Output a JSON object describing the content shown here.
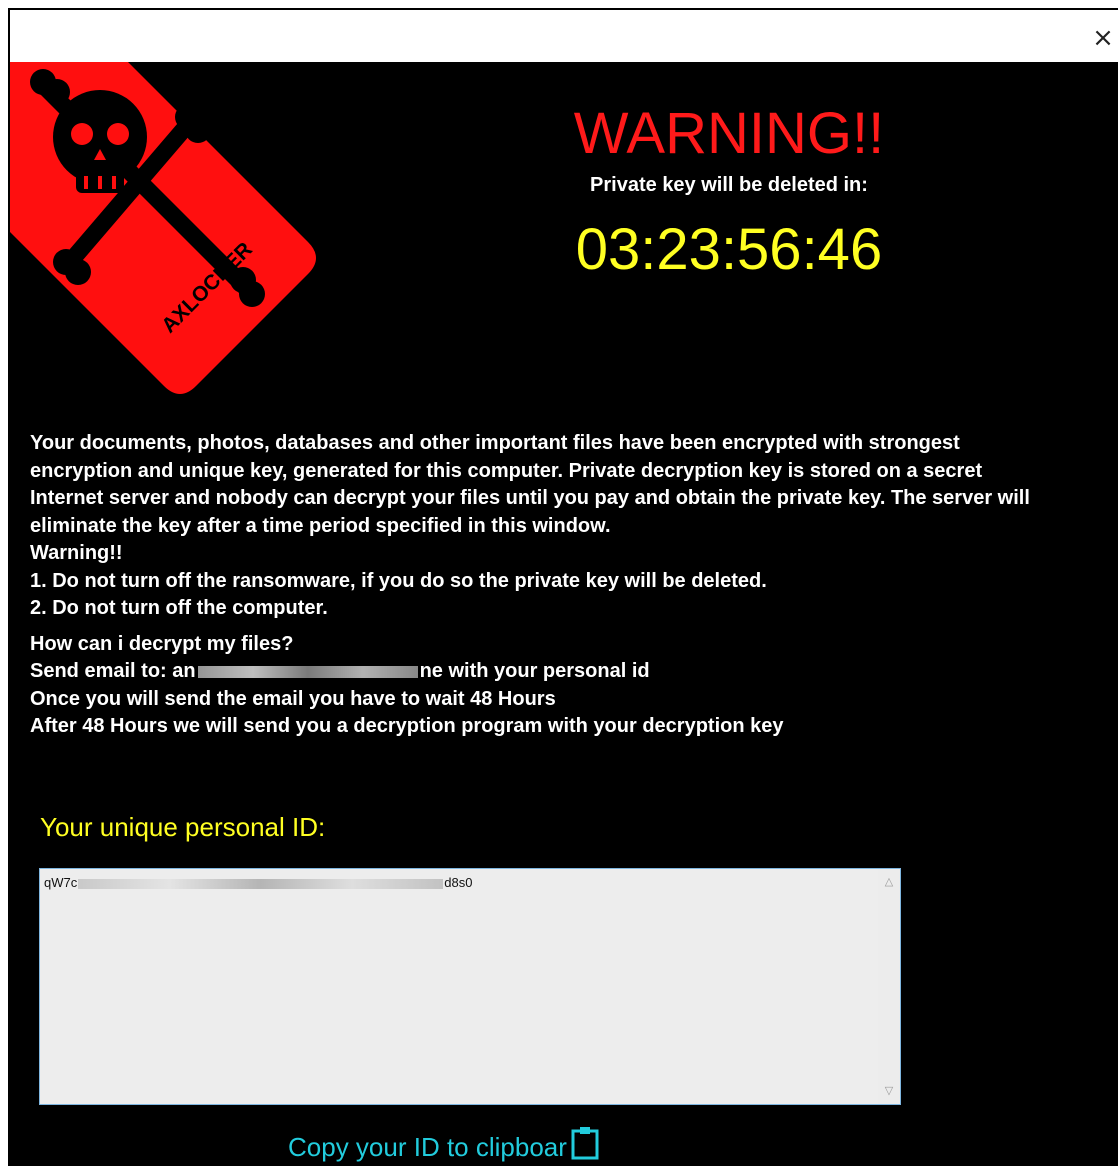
{
  "window": {
    "close_glyph": "×"
  },
  "logo": {
    "brand_text": "AXLOCKER",
    "colors": {
      "tag": "#ff0f0f",
      "figure": "#000000"
    }
  },
  "header": {
    "title": "WARNING!!",
    "subtitle": "Private key will be deleted in:",
    "timer": "03:23:56:46"
  },
  "message": {
    "paragraph": "Your documents, photos, databases and other important files have been encrypted with strongest encryption and unique key, generated for this computer. Private decryption key is stored on a secret Internet server and nobody can decrypt your files until you pay and obtain the private key. The server will eliminate the key after a time period specified in this window.",
    "warning_heading": "Warning!!",
    "warning_items": [
      "1. Do not turn off the ransomware,  if you do so the private key will be deleted.",
      "2. Do not turn off the computer."
    ],
    "howto_heading": "How can i decrypt my files?",
    "send_email_prefix": "Send email to: an",
    "send_email_suffix": "ne with your personal id",
    "wait_line": "Once you will send the email you have to wait 48 Hours",
    "after_line": "After 48 Hours we will send you a decryption program with your decryption key"
  },
  "personal_id": {
    "label": "Your unique personal ID:",
    "value_prefix": "qW7c",
    "value_suffix": "d8s0"
  },
  "copy": {
    "label": "Copy your ID to clipboar",
    "icon": "clipboard-icon"
  },
  "colors": {
    "background": "#000000",
    "warning": "#ff1a1a",
    "timer": "#ffff22",
    "id_label": "#ffff22",
    "copy_link": "#22ccdd",
    "text": "#ffffff"
  }
}
